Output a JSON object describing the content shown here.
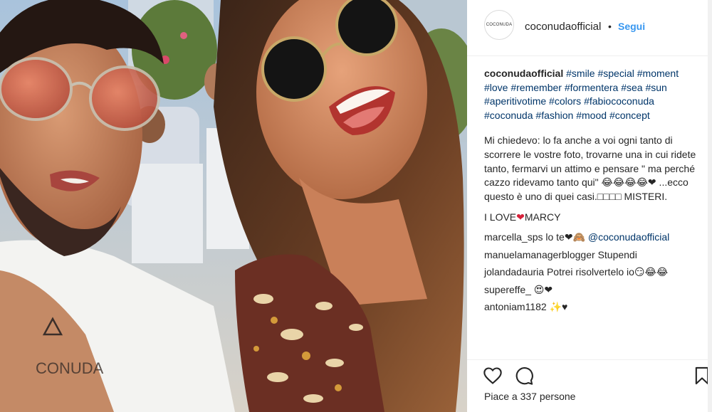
{
  "header": {
    "avatar_text": "COCONUDA",
    "username": "coconudaofficial",
    "dot": "•",
    "follow_label": "Segui"
  },
  "caption": {
    "username": "coconudaofficial",
    "hashtags": [
      "#smile",
      "#special",
      "#moment",
      "#love",
      "#remember",
      "#formentera",
      "#sea",
      "#sun",
      "#aperitivotime",
      "#colors",
      "#fabiococonuda",
      "#coconuda",
      "#fashion",
      "#mood",
      "#concept"
    ],
    "body": "Mi chiedevo: lo fa anche a voi ogni tanto di scorrere le vostre foto, trovarne una in cui ridete tanto, fermarvi un attimo e pensare \" ma perché cazzo ridevamo tanto qui\" 😂😂😂😂❤ ...ecco questo è uno di quei casi.□□□□ MISTERI.",
    "love_prefix": "I LOVE",
    "love_heart": "❤",
    "love_suffix": "MARCY"
  },
  "comments": [
    {
      "user": "marcella_sps",
      "text": "lo te❤🙈",
      "mention": "@coconudaofficial"
    },
    {
      "user": "manuelamanagerblogger",
      "text": "Stupendi",
      "mention": ""
    },
    {
      "user": "jolandadauria",
      "text": "Potrei risolvertelo io😏😂😂",
      "mention": ""
    },
    {
      "user": "supereffe_",
      "text": "😍❤",
      "mention": ""
    },
    {
      "user": "antoniam1182",
      "text": "✨♥",
      "mention": ""
    }
  ],
  "actions": {
    "like_icon": "heart-outline-icon",
    "comment_icon": "comment-bubble-icon",
    "save_icon": "bookmark-icon"
  },
  "likes_text": "Piace a 337 persone",
  "colors": {
    "link": "#003569",
    "follow": "#3897f0",
    "border": "#efefef"
  }
}
